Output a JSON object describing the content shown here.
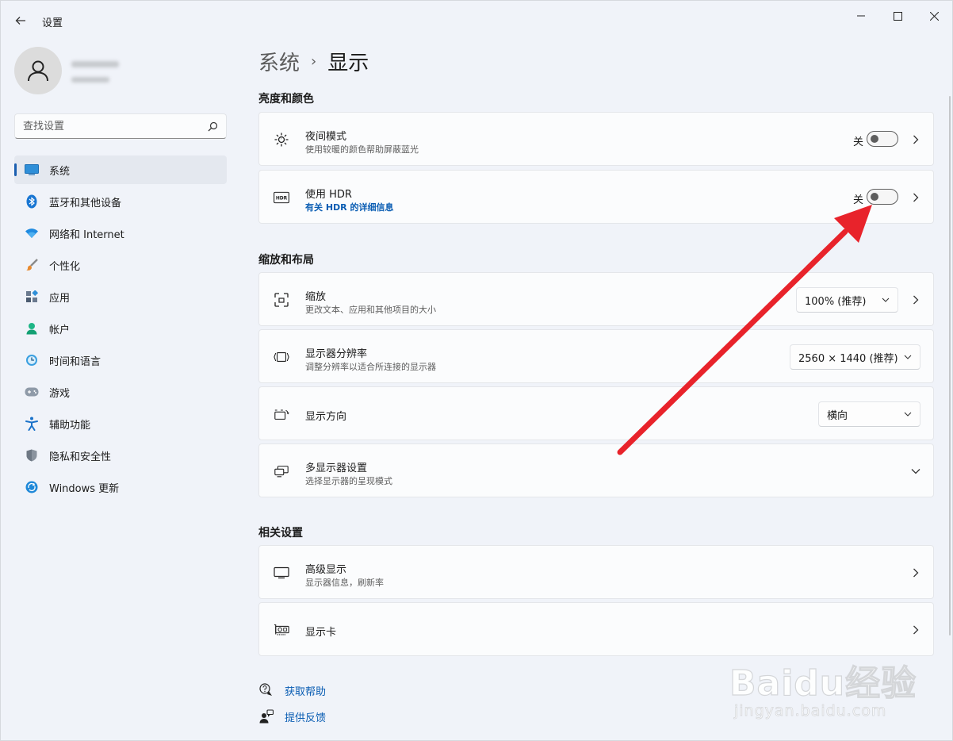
{
  "titlebar": {
    "app_title": "设置",
    "back_icon": "back-arrow-icon"
  },
  "sidebar": {
    "search_placeholder": "查找设置",
    "items": [
      {
        "label": "系统",
        "icon": "system-icon",
        "active": true
      },
      {
        "label": "蓝牙和其他设备",
        "icon": "bluetooth-icon"
      },
      {
        "label": "网络和 Internet",
        "icon": "network-icon"
      },
      {
        "label": "个性化",
        "icon": "personalize-brush-icon"
      },
      {
        "label": "应用",
        "icon": "apps-icon"
      },
      {
        "label": "帐户",
        "icon": "account-icon"
      },
      {
        "label": "时间和语言",
        "icon": "time-language-icon"
      },
      {
        "label": "游戏",
        "icon": "gaming-icon"
      },
      {
        "label": "辅助功能",
        "icon": "accessibility-icon"
      },
      {
        "label": "隐私和安全性",
        "icon": "shield-icon"
      },
      {
        "label": "Windows 更新",
        "icon": "windows-update-icon"
      }
    ]
  },
  "main": {
    "breadcrumb": {
      "parent": "系统",
      "separator": "›",
      "current": "显示"
    },
    "sections": {
      "brightness": "亮度和颜色",
      "scale_layout": "缩放和布局",
      "related": "相关设置"
    },
    "night_mode": {
      "title": "夜间模式",
      "subtitle": "使用较暖的颜色帮助屏蔽蓝光",
      "state": "关"
    },
    "hdr": {
      "title": "使用 HDR",
      "link": "有关 HDR 的详细信息",
      "state": "关"
    },
    "scale": {
      "title": "缩放",
      "subtitle": "更改文本、应用和其他项目的大小",
      "value": "100% (推荐)"
    },
    "resolution": {
      "title": "显示器分辨率",
      "subtitle": "调整分辨率以适合所连接的显示器",
      "value": "2560 × 1440 (推荐)"
    },
    "orientation": {
      "title": "显示方向",
      "value": "横向"
    },
    "multi_display": {
      "title": "多显示器设置",
      "subtitle": "选择显示器的呈现模式"
    },
    "advanced": {
      "title": "高级显示",
      "subtitle": "显示器信息，刷新率"
    },
    "graphics": {
      "title": "显示卡"
    },
    "help": {
      "get_help": "获取帮助",
      "feedback": "提供反馈"
    }
  },
  "watermark": {
    "logo": "Baidu经验",
    "url": "jingyan.baidu.com"
  },
  "colors": {
    "accent": "#0a5db3",
    "annotation_arrow": "#e8232b",
    "background": "#f0f3f9",
    "card": "#fbfcfd"
  }
}
